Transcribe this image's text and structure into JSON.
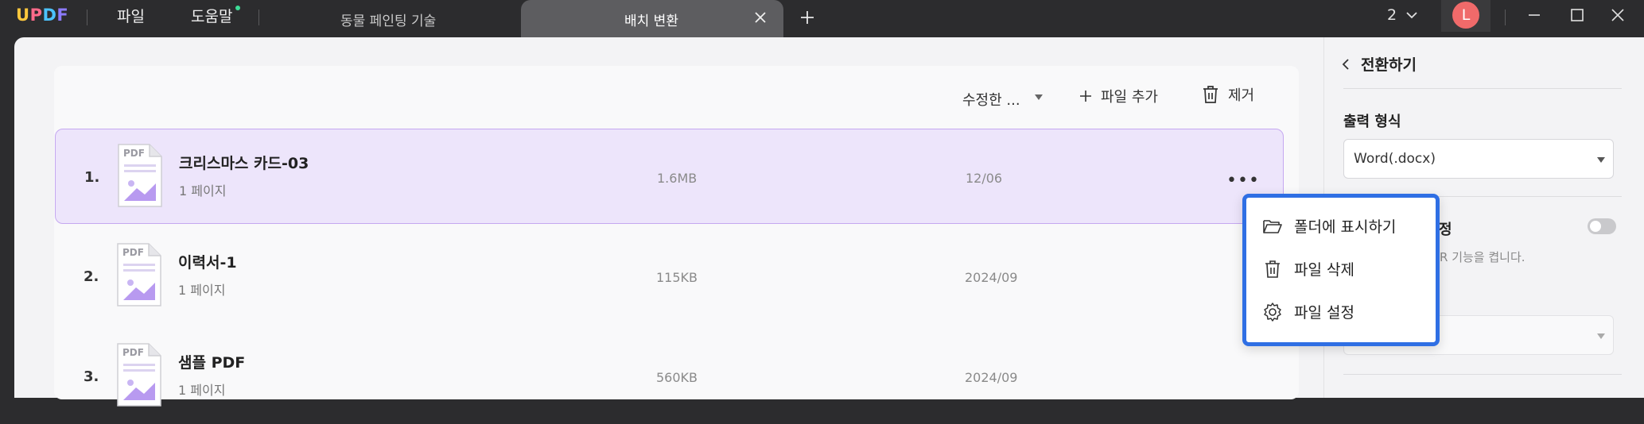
{
  "app": {
    "logo": "UPDF",
    "menu": {
      "file": "파일",
      "help": "도움말"
    },
    "tabs": [
      {
        "label": "동물 페인팅 기술",
        "active": false
      },
      {
        "label": "배치 변환",
        "active": true
      }
    ],
    "page_count": "2",
    "avatar_letter": "L"
  },
  "toolbar": {
    "sort_label": "수정한 ...",
    "add_label": "파일 추가",
    "remove_label": "제거"
  },
  "files": [
    {
      "index": "1.",
      "name": "크리스마스 카드-03",
      "pages": "1 페이지",
      "size": "1.6MB",
      "date": "12/06",
      "selected": true,
      "thumb_label": "PDF"
    },
    {
      "index": "2.",
      "name": "이력서-1",
      "pages": "1 페이지",
      "size": "115KB",
      "date": "2024/09",
      "selected": false,
      "thumb_label": "PDF"
    },
    {
      "index": "3.",
      "name": "샘플 PDF",
      "pages": "1 페이지",
      "size": "560KB",
      "date": "2024/09",
      "selected": false,
      "thumb_label": "PDF"
    }
  ],
  "context_menu": {
    "show_in_folder": "폴더에 표시하기",
    "delete_file": "파일 삭제",
    "file_settings": "파일 설정"
  },
  "right_panel": {
    "back_label": "전환하기",
    "output_format_label": "출력 형식",
    "output_format_value": "Word(.docx)",
    "ocr_label_visible": "정",
    "ocr_desc_visible": "R 기능을 켭니다.",
    "ocr_enabled": false
  },
  "colors": {
    "selected_row_bg": "#ede5fb",
    "selected_row_border": "#c5a8f0",
    "context_menu_border": "#2f6fe4",
    "avatar_bg": "#f06a6a"
  }
}
